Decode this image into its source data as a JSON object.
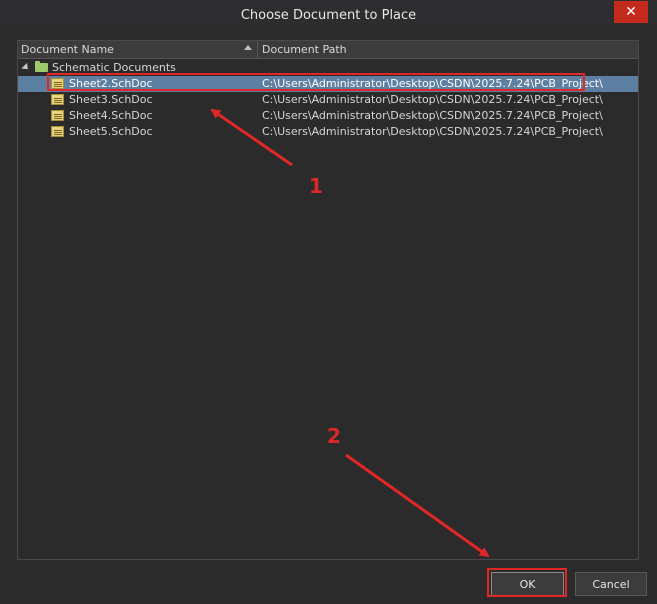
{
  "window": {
    "title": "Choose Document to Place",
    "close_label": "✕"
  },
  "table": {
    "columns": [
      "Document Name",
      "Document Path"
    ],
    "group": {
      "label": "Schematic Documents"
    },
    "rows": [
      {
        "name": "Sheet2.SchDoc",
        "path": "C:\\Users\\Administrator\\Desktop\\CSDN\\2025.7.24\\PCB_Project\\",
        "selected": true
      },
      {
        "name": "Sheet3.SchDoc",
        "path": "C:\\Users\\Administrator\\Desktop\\CSDN\\2025.7.24\\PCB_Project\\",
        "selected": false
      },
      {
        "name": "Sheet4.SchDoc",
        "path": "C:\\Users\\Administrator\\Desktop\\CSDN\\2025.7.24\\PCB_Project\\",
        "selected": false
      },
      {
        "name": "Sheet5.SchDoc",
        "path": "C:\\Users\\Administrator\\Desktop\\CSDN\\2025.7.24\\PCB_Project\\",
        "selected": false
      }
    ]
  },
  "buttons": {
    "ok": "OK",
    "cancel": "Cancel"
  },
  "annotations": {
    "step1": "1",
    "step2": "2",
    "color": "#e02727"
  },
  "icons": {
    "close": "close-icon",
    "sort": "sort-ascending-icon",
    "expander": "tree-expander-icon",
    "folder": "folder-icon",
    "document": "schematic-document-icon"
  }
}
